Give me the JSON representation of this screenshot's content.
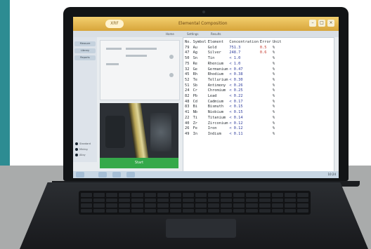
{
  "app": {
    "logo_text": "XRF",
    "window_title": "Elemental Composition",
    "window_controls": [
      "–",
      "□",
      "×"
    ]
  },
  "toolbar": {
    "tabs": [
      "Home",
      "Settings",
      "Results"
    ]
  },
  "sidebar": {
    "buttons": [
      "Measure",
      "Library",
      "Reports"
    ],
    "options": [
      "Standard",
      "Mining",
      "Alloy"
    ]
  },
  "start_button": "Start",
  "results": {
    "headers": [
      "No.",
      "Symbol",
      "Element",
      "Concentration",
      "Error",
      "Unit"
    ],
    "rows": [
      {
        "no": "79",
        "symbol": "Au",
        "element": "Gold",
        "conc": "751.3",
        "error": "0.5",
        "unit": "%"
      },
      {
        "no": "47",
        "symbol": "Ag",
        "element": "Silver",
        "conc": "248.7",
        "error": "0.6",
        "unit": "%"
      },
      {
        "no": "50",
        "symbol": "Sn",
        "element": "Tin",
        "conc": "< 1.0",
        "error": "",
        "unit": "%"
      },
      {
        "no": "75",
        "symbol": "Re",
        "element": "Rhenium",
        "conc": "< 1.0",
        "error": "",
        "unit": "%"
      },
      {
        "no": "32",
        "symbol": "Ge",
        "element": "Germanium",
        "conc": "< 0.47",
        "error": "",
        "unit": "%"
      },
      {
        "no": "45",
        "symbol": "Rh",
        "element": "Rhodium",
        "conc": "< 0.38",
        "error": "",
        "unit": "%"
      },
      {
        "no": "52",
        "symbol": "Te",
        "element": "Tellurium",
        "conc": "< 0.30",
        "error": "",
        "unit": "%"
      },
      {
        "no": "51",
        "symbol": "Sb",
        "element": "Antimony",
        "conc": "< 0.26",
        "error": "",
        "unit": "%"
      },
      {
        "no": "24",
        "symbol": "Cr",
        "element": "Chromium",
        "conc": "< 0.25",
        "error": "",
        "unit": "%"
      },
      {
        "no": "82",
        "symbol": "Pb",
        "element": "Lead",
        "conc": "< 0.22",
        "error": "",
        "unit": "%"
      },
      {
        "no": "48",
        "symbol": "Cd",
        "element": "Cadmium",
        "conc": "< 0.17",
        "error": "",
        "unit": "%"
      },
      {
        "no": "83",
        "symbol": "Bi",
        "element": "Bismuth",
        "conc": "< 0.15",
        "error": "",
        "unit": "%"
      },
      {
        "no": "41",
        "symbol": "Nb",
        "element": "Niobium",
        "conc": "< 0.15",
        "error": "",
        "unit": "%"
      },
      {
        "no": "22",
        "symbol": "Ti",
        "element": "Titanium",
        "conc": "< 0.14",
        "error": "",
        "unit": "%"
      },
      {
        "no": "40",
        "symbol": "Zr",
        "element": "Zirconium",
        "conc": "< 0.12",
        "error": "",
        "unit": "%"
      },
      {
        "no": "26",
        "symbol": "Fe",
        "element": "Iron",
        "conc": "< 0.12",
        "error": "",
        "unit": "%"
      },
      {
        "no": "49",
        "symbol": "In",
        "element": "Indium",
        "conc": "< 0.11",
        "error": "",
        "unit": "%"
      }
    ]
  },
  "taskbar": {
    "clock": "10:24"
  },
  "colors": {
    "title_bar": "#e2b650",
    "start_button": "#35a94a",
    "concentration_text": "#2c3a9a",
    "error_text": "#c4372a",
    "teal_wall": "#2d8c92"
  }
}
